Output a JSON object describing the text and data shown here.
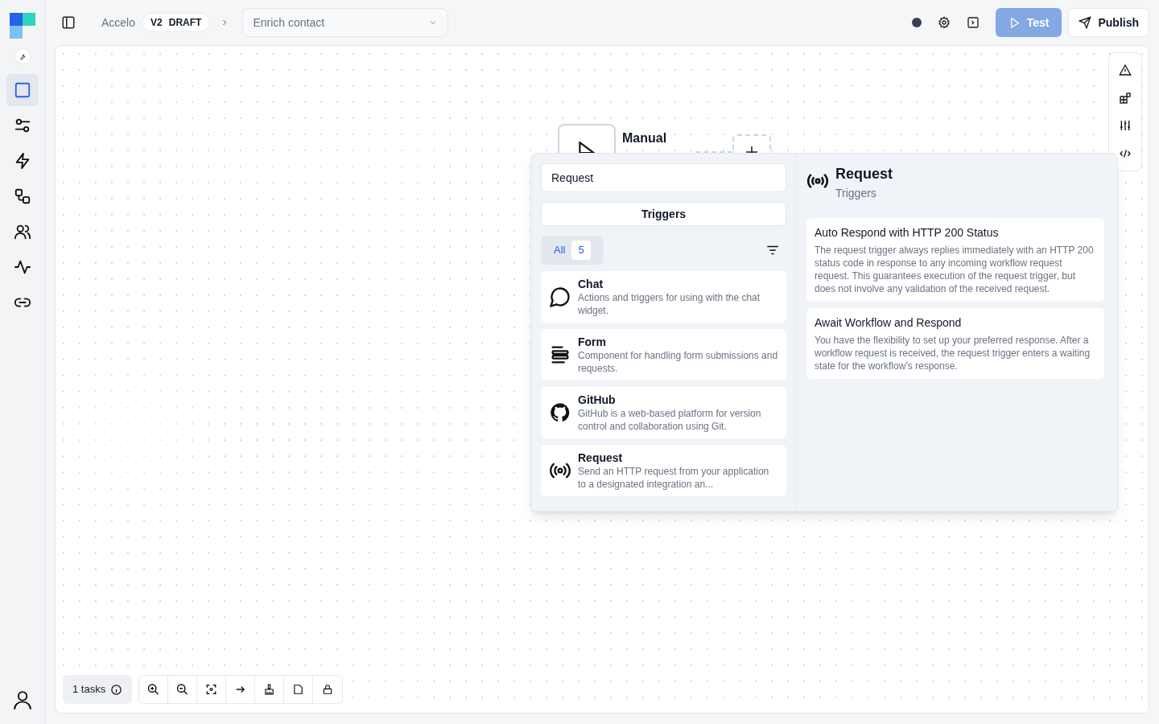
{
  "header": {
    "workspace": "Accelo",
    "version": "V2",
    "status": "DRAFT",
    "workflow": "Enrich contact",
    "test_button": "Test",
    "publish_button": "Publish"
  },
  "sidebar": {
    "items": [
      {
        "kind": "square",
        "selected": true
      },
      {
        "kind": "sliders",
        "selected": false
      },
      {
        "kind": "bolt",
        "selected": false
      },
      {
        "kind": "shapes",
        "selected": false
      },
      {
        "kind": "users",
        "selected": false
      },
      {
        "kind": "activity",
        "selected": false
      },
      {
        "kind": "link",
        "selected": false
      }
    ]
  },
  "node": {
    "title": "Manual"
  },
  "panel": {
    "search": "Request",
    "category": "Triggers",
    "filter": {
      "label": "All",
      "count": "5",
      "selected": true
    },
    "items": [
      {
        "kind": "chat",
        "title": "Chat",
        "description": "Actions and triggers for using with the chat widget."
      },
      {
        "kind": "form",
        "title": "Form",
        "description": "Component for handling form submissions and requests."
      },
      {
        "kind": "github",
        "title": "GitHub",
        "description": "GitHub is a web-based platform for version control and collaboration using Git."
      },
      {
        "kind": "request",
        "title": "Request",
        "description": "Send an HTTP request from your application to a designated integration an..."
      }
    ],
    "detail": {
      "title": "Request",
      "subtitle": "Triggers",
      "options": [
        {
          "title": "Auto Respond with HTTP 200 Status",
          "description": "The request trigger always replies immediately with an HTTP 200 status code in response to any incoming workflow request request. This guarantees execution of the request trigger, but does not involve any validation of the received request."
        },
        {
          "title": "Await Workflow and Respond",
          "description": "You have the flexibility to set up your preferred response. After a workflow request is received, the request trigger enters a waiting state for the workflow's response."
        }
      ]
    }
  },
  "footer": {
    "tasks": "1 tasks"
  }
}
